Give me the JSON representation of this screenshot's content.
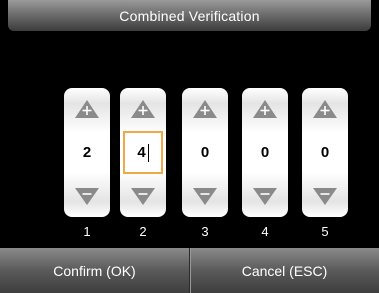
{
  "title": "Combined Verification",
  "wheels": [
    {
      "value": "2",
      "label": "1",
      "active": false
    },
    {
      "value": "4",
      "label": "2",
      "active": true
    },
    {
      "value": "0",
      "label": "3",
      "active": false
    },
    {
      "value": "0",
      "label": "4",
      "active": false
    },
    {
      "value": "0",
      "label": "5",
      "active": false
    }
  ],
  "buttons": {
    "confirm": "Confirm (OK)",
    "cancel": "Cancel (ESC)"
  },
  "colors": {
    "background": "#000000",
    "active_border": "#f0a848",
    "arrow": "#8a8a8a"
  }
}
